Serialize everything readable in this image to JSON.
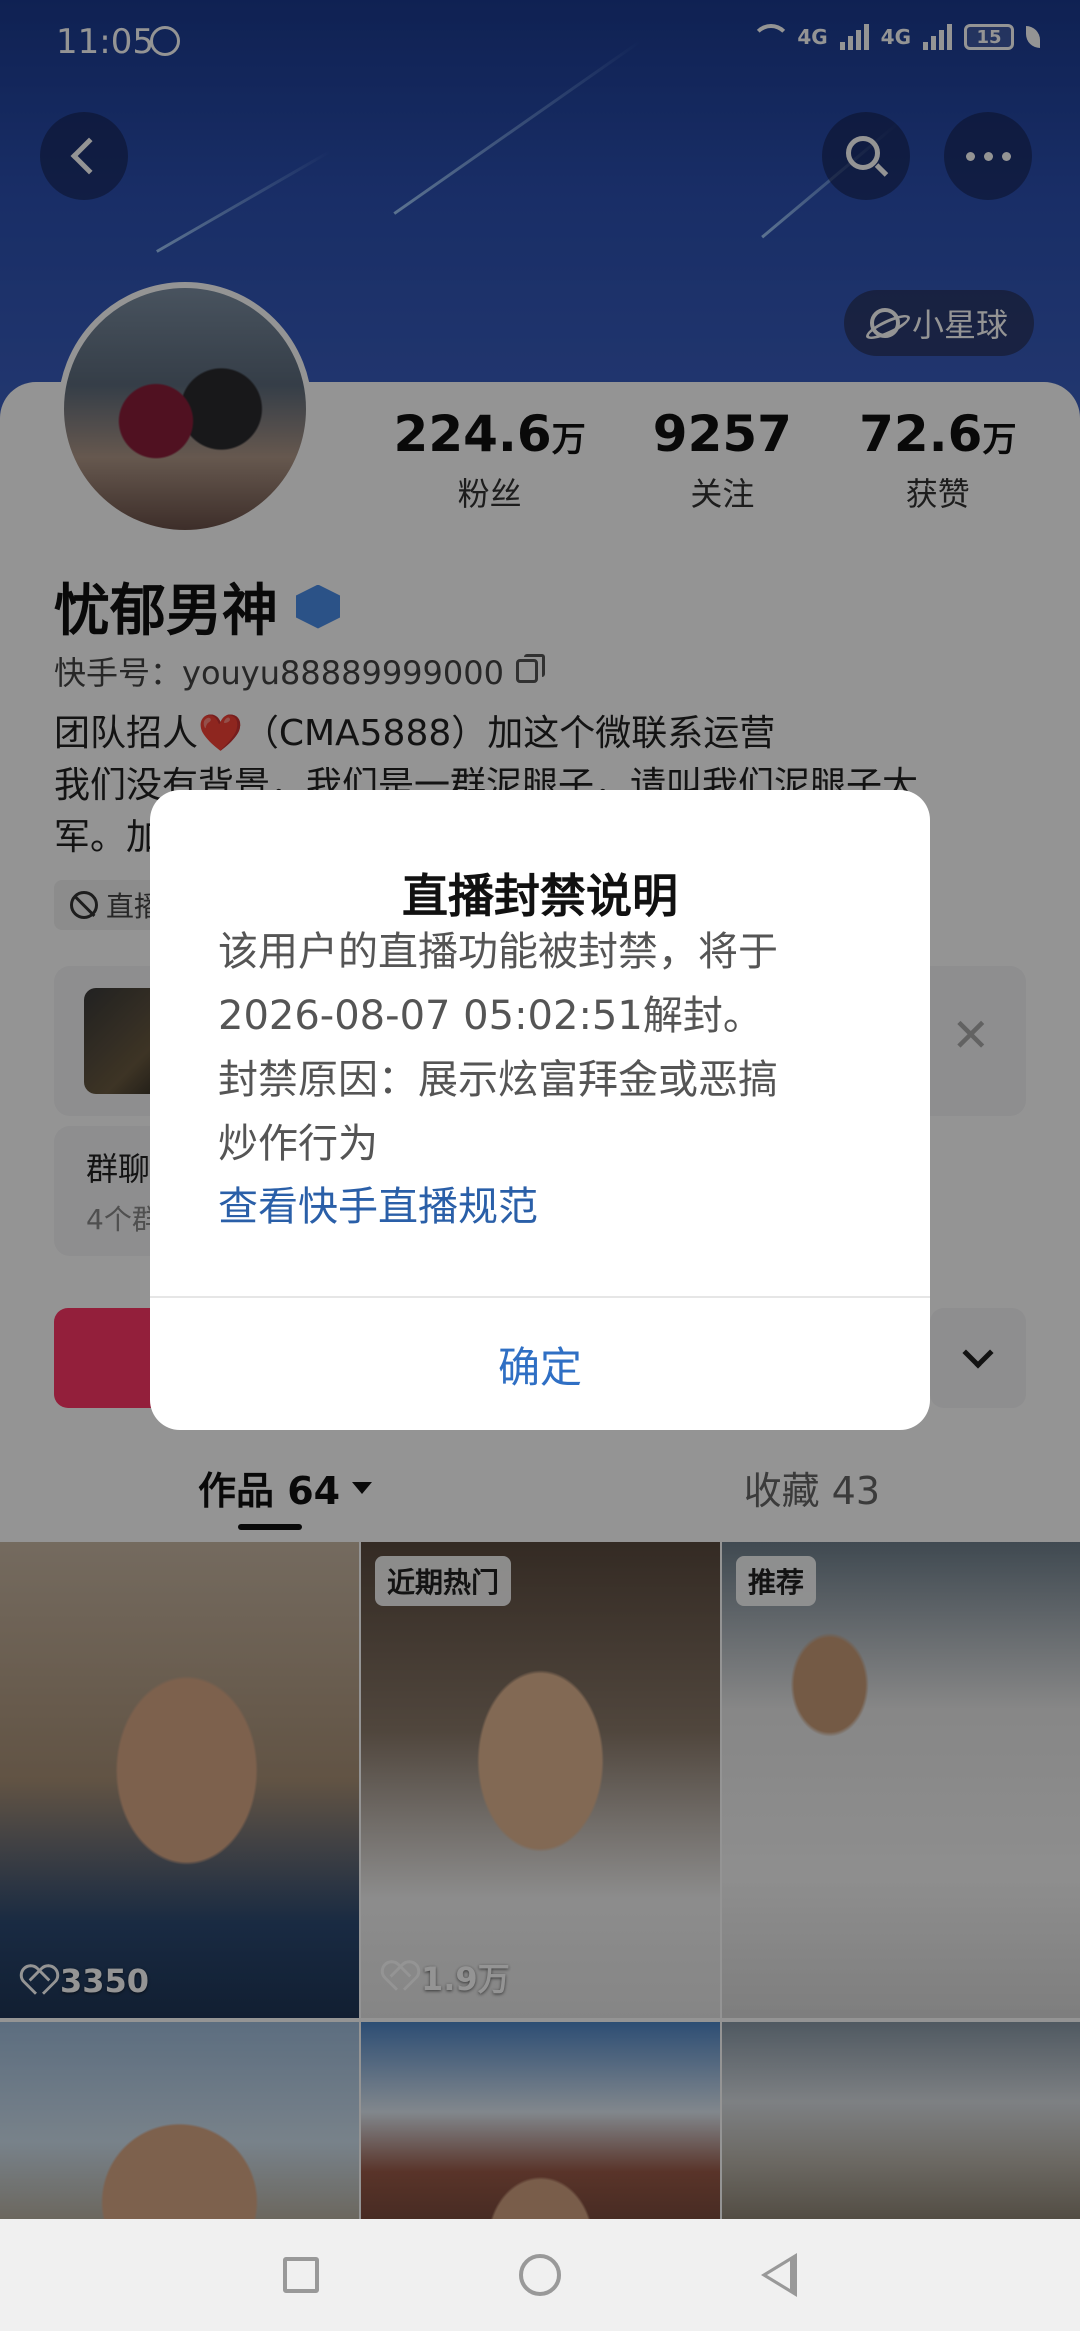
{
  "status_bar": {
    "time": "11:05",
    "network_1": "4G",
    "network_2": "4G",
    "battery": "15"
  },
  "header": {
    "planet_label": "小星球"
  },
  "profile": {
    "stats": [
      {
        "num": "224.6",
        "unit": "万",
        "label": "粉丝"
      },
      {
        "num": "9257",
        "unit": "",
        "label": "关注"
      },
      {
        "num": "72.6",
        "unit": "万",
        "label": "获赞"
      }
    ],
    "name": "忧郁男神",
    "uid": "快手号：youyu88889999000",
    "bio_line1": "团队招人❤️（CMA5888）加这个微联系运营",
    "bio_line2": "我们没有背景，我们是一群泥腿子，请叫我们泥腿子大",
    "bio_line3": "军。加",
    "live_tag": "直播",
    "group_title": "群聊",
    "group_sub": "4个群"
  },
  "tabs": {
    "works": "作品 64",
    "favorites": "收藏 43"
  },
  "grid": [
    {
      "badge": "",
      "likes": "3350"
    },
    {
      "badge": "近期热门",
      "likes": "1.9万"
    },
    {
      "badge": "推荐",
      "likes": ""
    },
    {
      "badge": "",
      "likes": ""
    },
    {
      "badge": "",
      "likes": ""
    },
    {
      "badge": "",
      "likes": ""
    }
  ],
  "dialog": {
    "title": "直播封禁说明",
    "body_line1": "该用户的直播功能被封禁，将于",
    "body_line2": "2026-08-07 05:02:51解封。",
    "body_line3": "封禁原因：展示炫富拜金或恶搞",
    "body_line4": "炒作行为",
    "link": "查看快手直播规范",
    "confirm": "确定"
  },
  "colors": {
    "accent_red": "#fe3666",
    "link_blue": "#2a5fa8",
    "confirm_blue": "#2f6fc4",
    "banner_blue": "#2b4fb0"
  }
}
